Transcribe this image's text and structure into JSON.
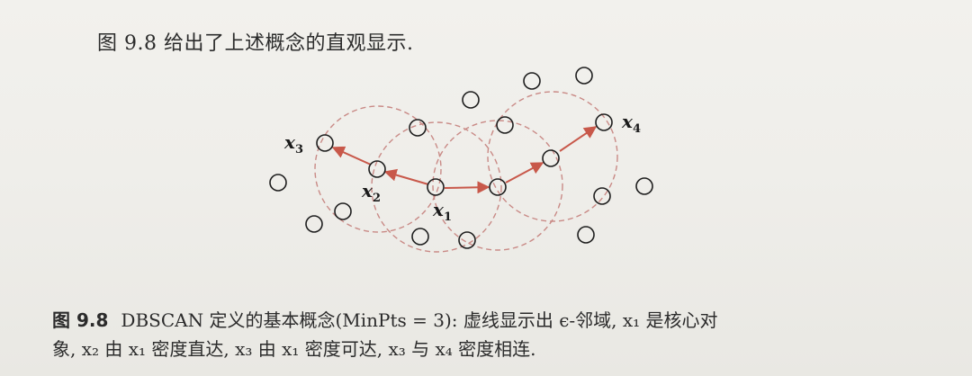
{
  "intro_text": "图 9.8 给出了上述概念的直观显示.",
  "figure": {
    "labels": {
      "x1": {
        "base": "x",
        "sub": "1"
      },
      "x2": {
        "base": "x",
        "sub": "2"
      },
      "x3": {
        "base": "x",
        "sub": "3"
      },
      "x4": {
        "base": "x",
        "sub": "4"
      }
    }
  },
  "caption": {
    "figure_number": "图 9.8",
    "line1": "DBSCAN 定义的基本概念(MinPts = 3): 虚线显示出 ϵ-邻域, x₁ 是核心对",
    "line2": "象, x₂ 由 x₁ 密度直达, x₃ 由 x₁ 密度可达, x₃ 与 x₄ 密度相连."
  },
  "colors": {
    "neighborhood_dash": "#c98a86",
    "arrow": "#c8584a",
    "point_stroke": "#1e1e1e",
    "text": "#2b2b2b"
  }
}
